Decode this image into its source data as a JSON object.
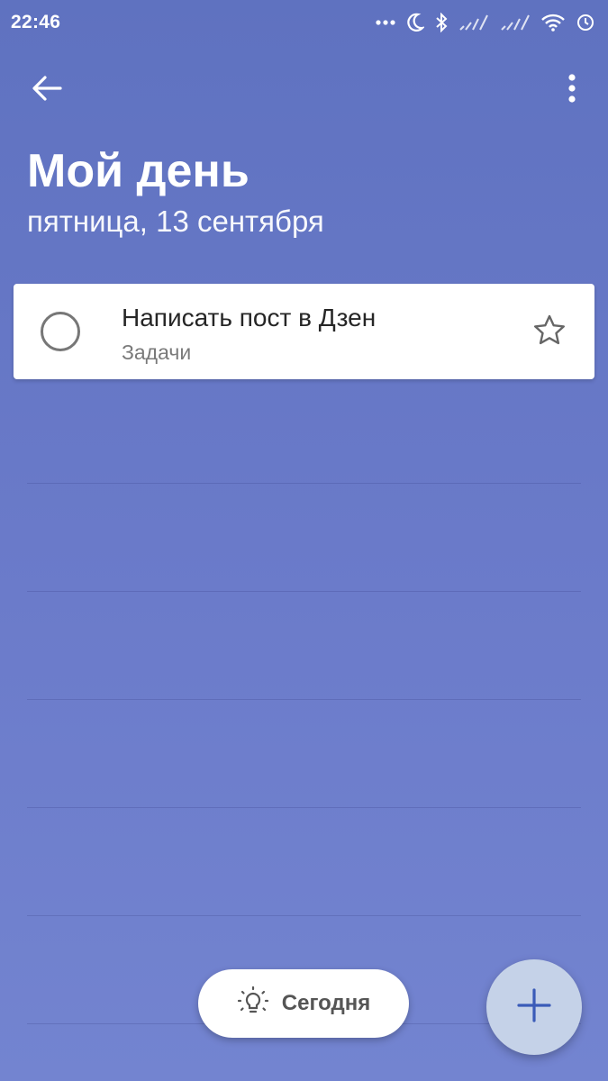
{
  "status_bar": {
    "time": "22:46",
    "icons": [
      "more-dots-icon",
      "moon-icon",
      "bluetooth-icon",
      "signal-icon",
      "signal-icon",
      "wifi-icon",
      "sync-icon"
    ]
  },
  "app_bar": {
    "back_icon": "arrow-left-icon",
    "more_icon": "more-vertical-icon"
  },
  "header": {
    "title": "Мой день",
    "subtitle": "пятница, 13 сентября"
  },
  "tasks": [
    {
      "title": "Написать пост в Дзен",
      "list": "Задачи",
      "completed": false,
      "starred": false
    }
  ],
  "suggestions_button": {
    "label": "Сегодня",
    "icon": "lightbulb-icon"
  },
  "add_button": {
    "icon": "plus-icon"
  },
  "colors": {
    "background_top": "#5f72c0",
    "background_bottom": "#7384d0",
    "card": "#ffffff",
    "fab": "#c5d2e8",
    "fab_icon": "#3a5bb8"
  }
}
